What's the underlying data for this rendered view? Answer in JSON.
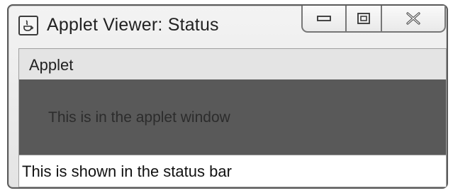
{
  "window": {
    "title": "Applet Viewer: Status",
    "icon": "java-app-icon",
    "controls": {
      "minimize_icon": "minimize-icon",
      "maximize_icon": "maximize-icon",
      "close_icon": "close-icon"
    }
  },
  "menubar": {
    "items": [
      {
        "label": "Applet"
      }
    ]
  },
  "applet": {
    "message": "This is in the applet window",
    "background": "#595959"
  },
  "statusbar": {
    "text": "This is shown in the status bar"
  }
}
